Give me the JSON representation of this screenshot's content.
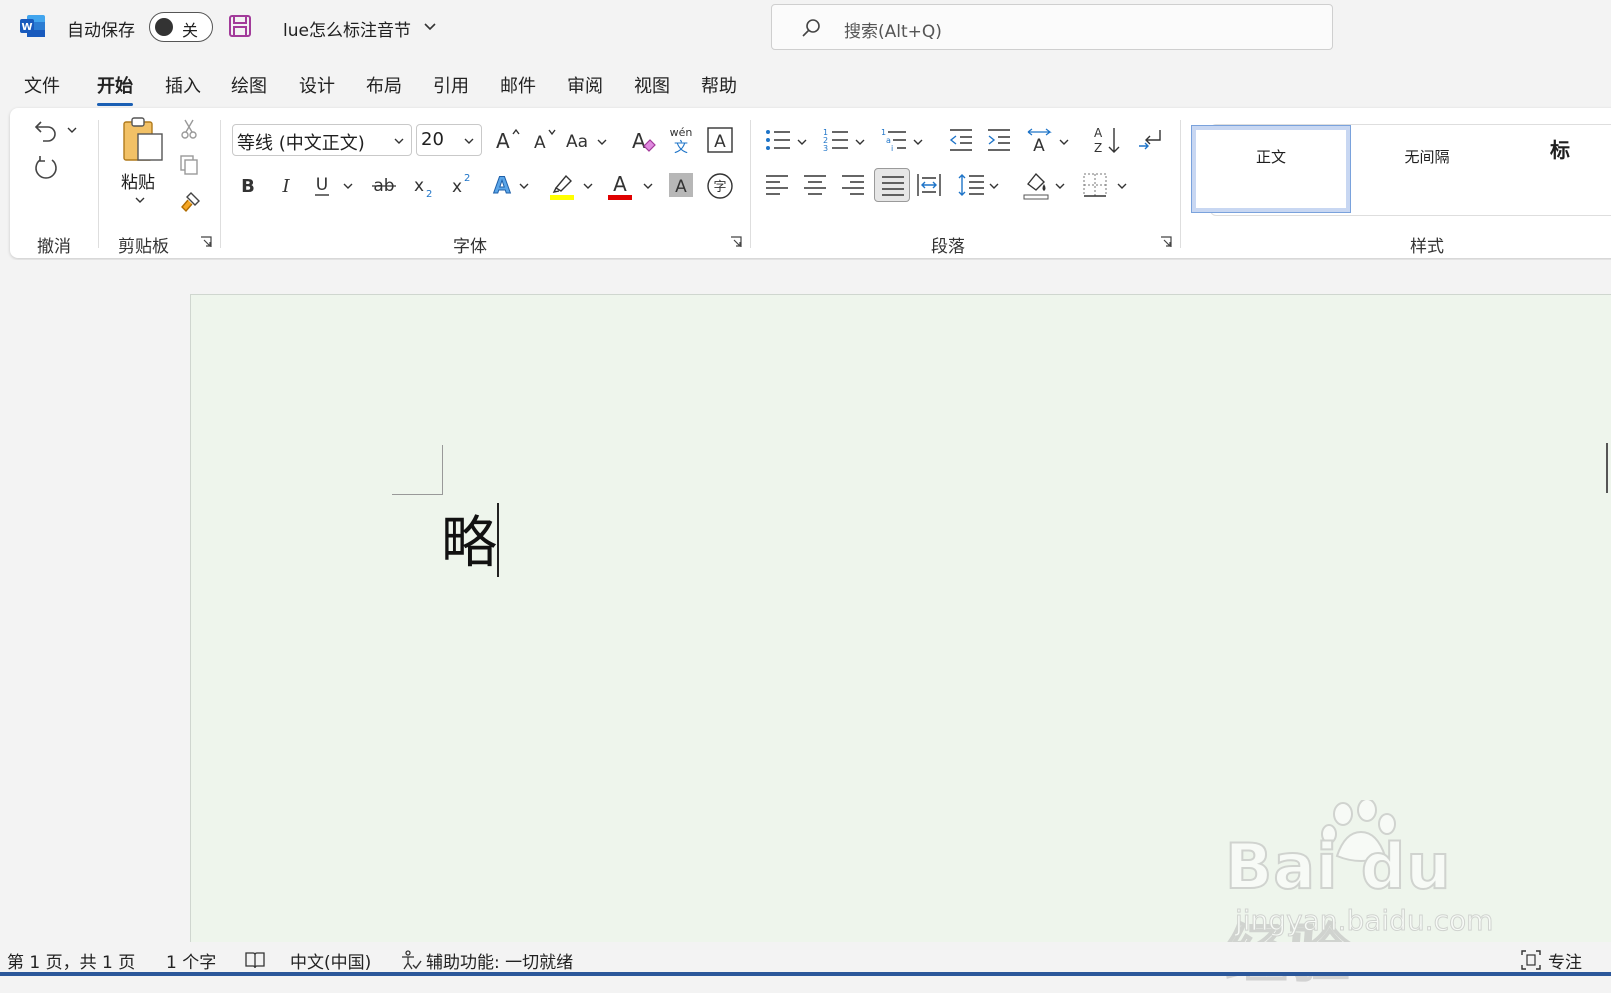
{
  "titlebar": {
    "autosave_label": "自动保存",
    "autosave_state": "关",
    "document_title": "lue怎么标注音节",
    "search_placeholder": "搜索(Alt+Q)"
  },
  "menu_tabs": [
    "文件",
    "开始",
    "插入",
    "绘图",
    "设计",
    "布局",
    "引用",
    "邮件",
    "审阅",
    "视图",
    "帮助"
  ],
  "active_tab": "开始",
  "ribbon": {
    "undo_group_label": "撤消",
    "clipboard_group_label": "剪贴板",
    "paste_label": "粘贴",
    "font_group_label": "字体",
    "font_name": "等线 (中文正文)",
    "font_size": "20",
    "phonetic_wen": "wén",
    "phonetic_char": "文",
    "paragraph_group_label": "段落",
    "styles_group_label": "样式",
    "styles": [
      "正文",
      "无间隔",
      "标"
    ]
  },
  "document": {
    "text": "略"
  },
  "watermark": {
    "main": "Bai du 经验",
    "sub": "jingyan.baidu.com"
  },
  "statusbar": {
    "page_info": "第 1 页，共 1 页",
    "word_count": "1 个字",
    "language": "中文(中国)",
    "accessibility": "辅助功能: 一切就绪",
    "focus": "专注"
  },
  "colors": {
    "word_blue": "#2b579a",
    "highlight_yellow": "#ffff00",
    "font_color_red": "#e00000",
    "page_background": "#eef5ec"
  }
}
